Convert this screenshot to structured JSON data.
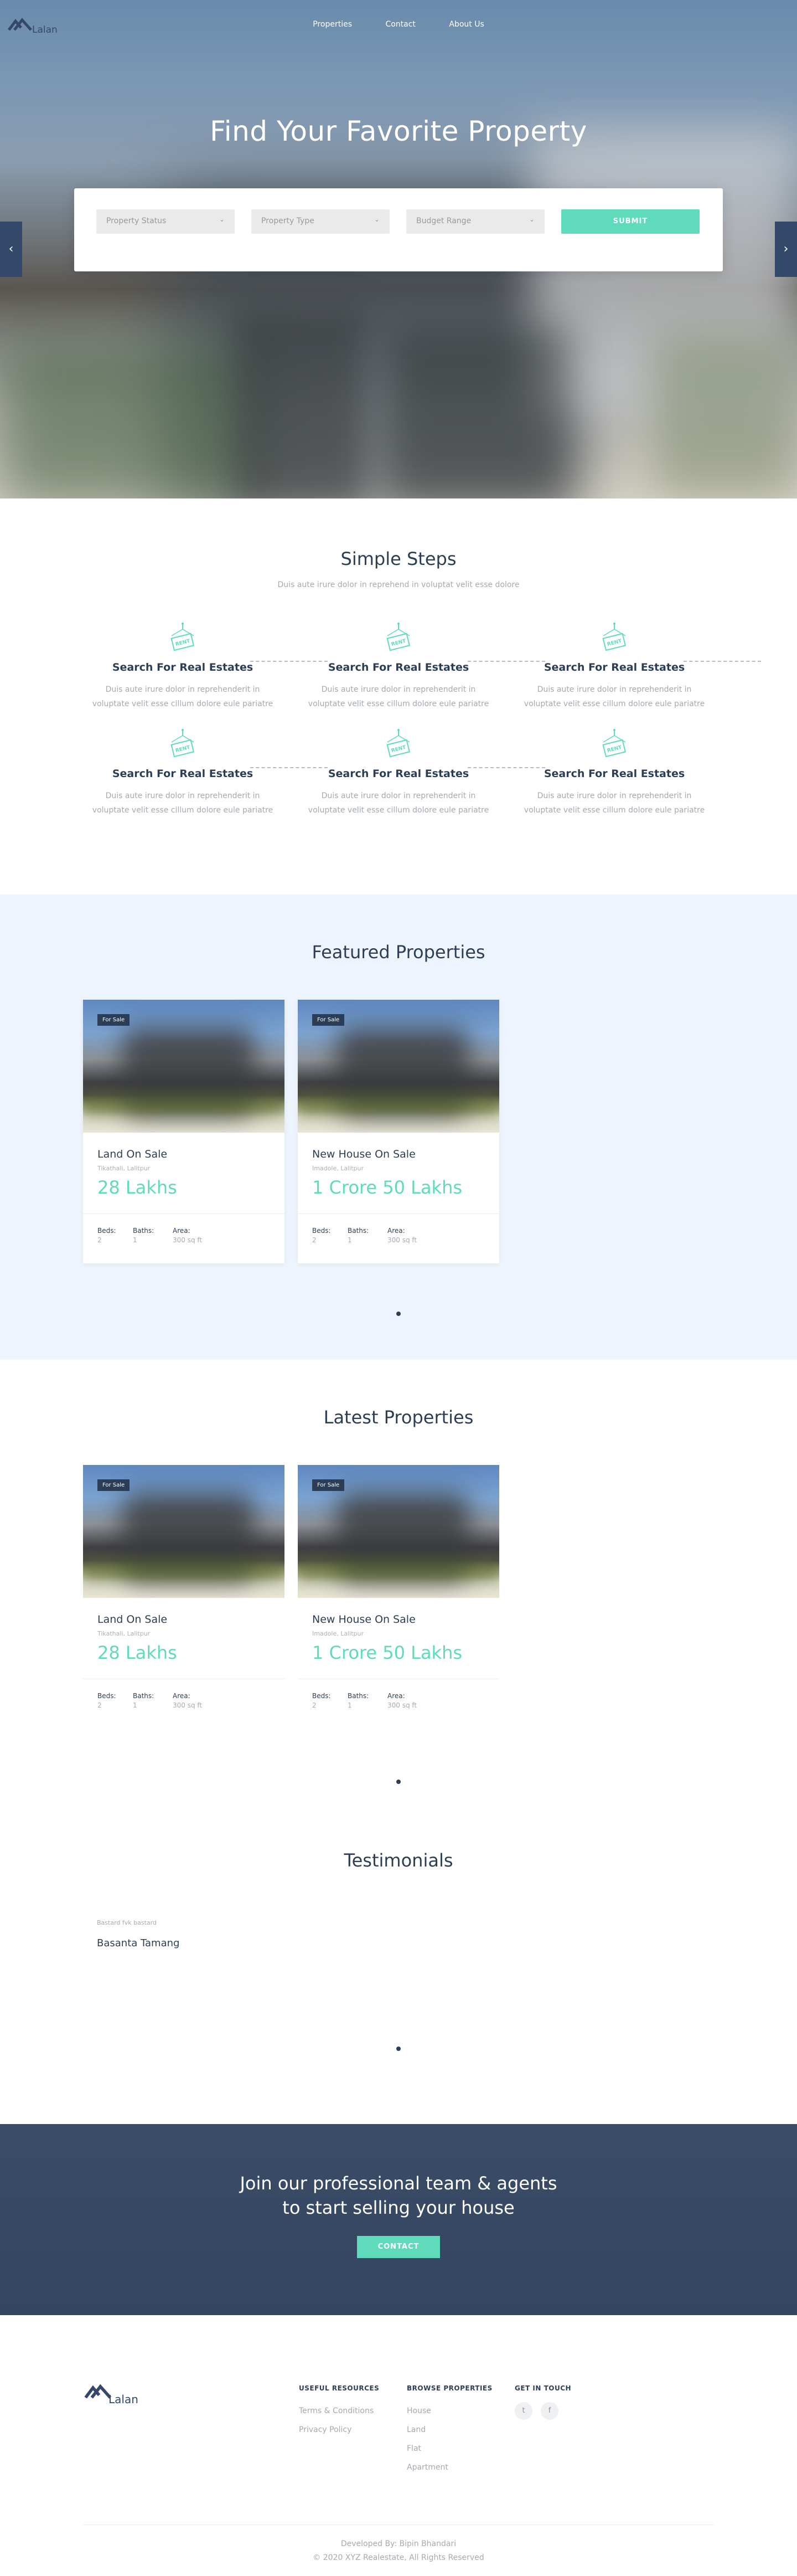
{
  "brand": {
    "name": "Lalan"
  },
  "nav": {
    "items": [
      "Properties",
      "Contact",
      "About Us"
    ]
  },
  "hero": {
    "title": "Find Your Favorite Property",
    "selects": [
      "Property Status",
      "Property Type",
      "Budget Range"
    ],
    "submit": "SUBMIT",
    "prev": "‹",
    "next": "›"
  },
  "steps": {
    "title": "Simple Steps",
    "subtitle": "Duis aute irure dolor in reprehend in voluptat velit esse dolore",
    "badge_text": "RENT",
    "items": [
      {
        "title": "Search For Real Estates",
        "text": "Duis aute irure dolor in reprehenderit in voluptate velit esse cillum dolore eule pariatre"
      },
      {
        "title": "Search For Real Estates",
        "text": "Duis aute irure dolor in reprehenderit in voluptate velit esse cillum dolore eule pariatre"
      },
      {
        "title": "Search For Real Estates",
        "text": "Duis aute irure dolor in reprehenderit in voluptate velit esse cillum dolore eule pariatre"
      },
      {
        "title": "Search For Real Estates",
        "text": "Duis aute irure dolor in reprehenderit in voluptate velit esse cillum dolore eule pariatre"
      },
      {
        "title": "Search For Real Estates",
        "text": "Duis aute irure dolor in reprehenderit in voluptate velit esse cillum dolore eule pariatre"
      },
      {
        "title": "Search For Real Estates",
        "text": "Duis aute irure dolor in reprehenderit in voluptate velit esse cillum dolore eule pariatre"
      }
    ]
  },
  "featured": {
    "title": "Featured Properties",
    "cards": [
      {
        "badge": "For Sale",
        "title": "Land On Sale",
        "location": "Tikathali, Lalitpur",
        "price": "28 Lakhs",
        "beds_label": "Beds:",
        "beds": "2",
        "baths_label": "Baths:",
        "baths": "1",
        "area_label": "Area:",
        "area": "300 sq ft"
      },
      {
        "badge": "For Sale",
        "title": "New House On Sale",
        "location": "Imadole, Lalitpur",
        "price": "1 Crore 50 Lakhs",
        "beds_label": "Beds:",
        "beds": "2",
        "baths_label": "Baths:",
        "baths": "1",
        "area_label": "Area:",
        "area": "300 sq ft"
      }
    ]
  },
  "latest": {
    "title": "Latest Properties",
    "cards": [
      {
        "badge": "For Sale",
        "title": "Land On Sale",
        "location": "Tikathali, Lalitpur",
        "price": "28 Lakhs",
        "beds_label": "Beds:",
        "beds": "2",
        "baths_label": "Baths:",
        "baths": "1",
        "area_label": "Area:",
        "area": "300 sq ft"
      },
      {
        "badge": "For Sale",
        "title": "New House On Sale",
        "location": "Imadole, Lalitpur",
        "price": "1 Crore 50 Lakhs",
        "beds_label": "Beds:",
        "beds": "2",
        "baths_label": "Baths:",
        "baths": "1",
        "area_label": "Area:",
        "area": "300 sq ft"
      }
    ]
  },
  "testimonials": {
    "title": "Testimonials",
    "items": [
      {
        "quote": "Bastard fvk bastard",
        "name": "Basanta Tamang"
      }
    ]
  },
  "cta": {
    "line1": "Join our professional team & agents",
    "line2": "to start selling your house",
    "button": "CONTACT"
  },
  "footer": {
    "useful": {
      "title": "USEFUL RESOURCES",
      "links": [
        "Terms & Conditions",
        "Privacy Policy"
      ]
    },
    "browse": {
      "title": "BROWSE PROPERTIES",
      "links": [
        "House",
        "Land",
        "Flat",
        "Apartment"
      ]
    },
    "touch": {
      "title": "GET IN TOUCH",
      "icons": [
        "twitter-icon",
        "facebook-icon"
      ]
    },
    "developed": "Developed By: Bipin Bhandari",
    "copyright": "© 2020 XYZ Realestate, All Rights Reserved"
  },
  "colors": {
    "accent": "#5fdbbc",
    "navy": "#2c3e55",
    "featured_bg": "#eef4fd"
  }
}
